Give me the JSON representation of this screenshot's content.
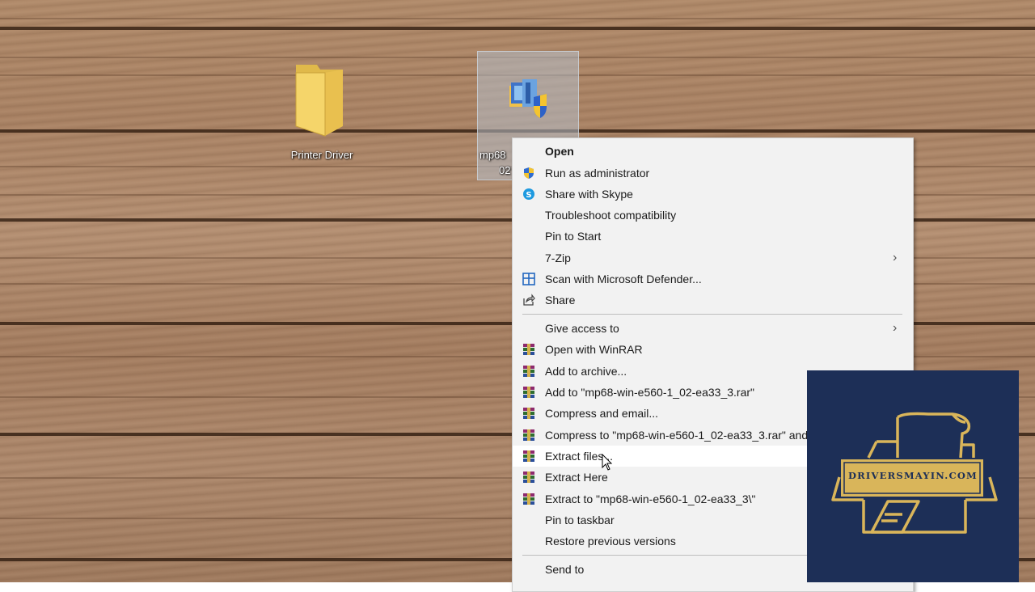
{
  "desktop": {
    "icons": [
      {
        "label": "Printer Driver",
        "kind": "folder-icon"
      },
      {
        "label": "mp68",
        "label_line2": "02",
        "kind": "setup-exe-icon",
        "selected": true
      }
    ]
  },
  "context_menu": {
    "items": [
      {
        "label": "Open",
        "bold": true
      },
      {
        "label": "Run as administrator",
        "icon": "uac-shield-icon"
      },
      {
        "label": "Share with Skype",
        "icon": "skype-icon"
      },
      {
        "label": "Troubleshoot compatibility"
      },
      {
        "label": "Pin to Start"
      },
      {
        "label": "7-Zip",
        "submenu": true
      },
      {
        "label": "Scan with Microsoft Defender...",
        "icon": "defender-icon"
      },
      {
        "label": "Share",
        "icon": "share-icon"
      },
      {
        "label": "Give access to",
        "submenu": true
      },
      {
        "label": "Open with WinRAR",
        "icon": "winrar-icon"
      },
      {
        "label": "Add to archive...",
        "icon": "winrar-icon"
      },
      {
        "label": "Add to \"mp68-win-e560-1_02-ea33_3.rar\"",
        "icon": "winrar-icon"
      },
      {
        "label": "Compress and email...",
        "icon": "winrar-icon"
      },
      {
        "label": "Compress to \"mp68-win-e560-1_02-ea33_3.rar\" and",
        "icon": "winrar-icon"
      },
      {
        "label": "Extract files...",
        "icon": "winrar-icon",
        "hovered": true
      },
      {
        "label": "Extract Here",
        "icon": "winrar-icon"
      },
      {
        "label": "Extract to \"mp68-win-e560-1_02-ea33_3\\\"",
        "icon": "winrar-icon"
      },
      {
        "label": "Pin to taskbar"
      },
      {
        "label": "Restore previous versions"
      },
      {
        "label": "Send to",
        "submenu": true
      }
    ],
    "chevron": "›"
  },
  "watermark": {
    "text": "DRIVERSMAYIN.COM",
    "icon": "printer-logo-icon",
    "colors": {
      "background": "#1d2f57",
      "gold": "#d9b55a"
    }
  },
  "colors": {
    "menu_background": "#f2f2f2",
    "menu_hover": "#ffffff",
    "selection": "#b4bec8"
  }
}
